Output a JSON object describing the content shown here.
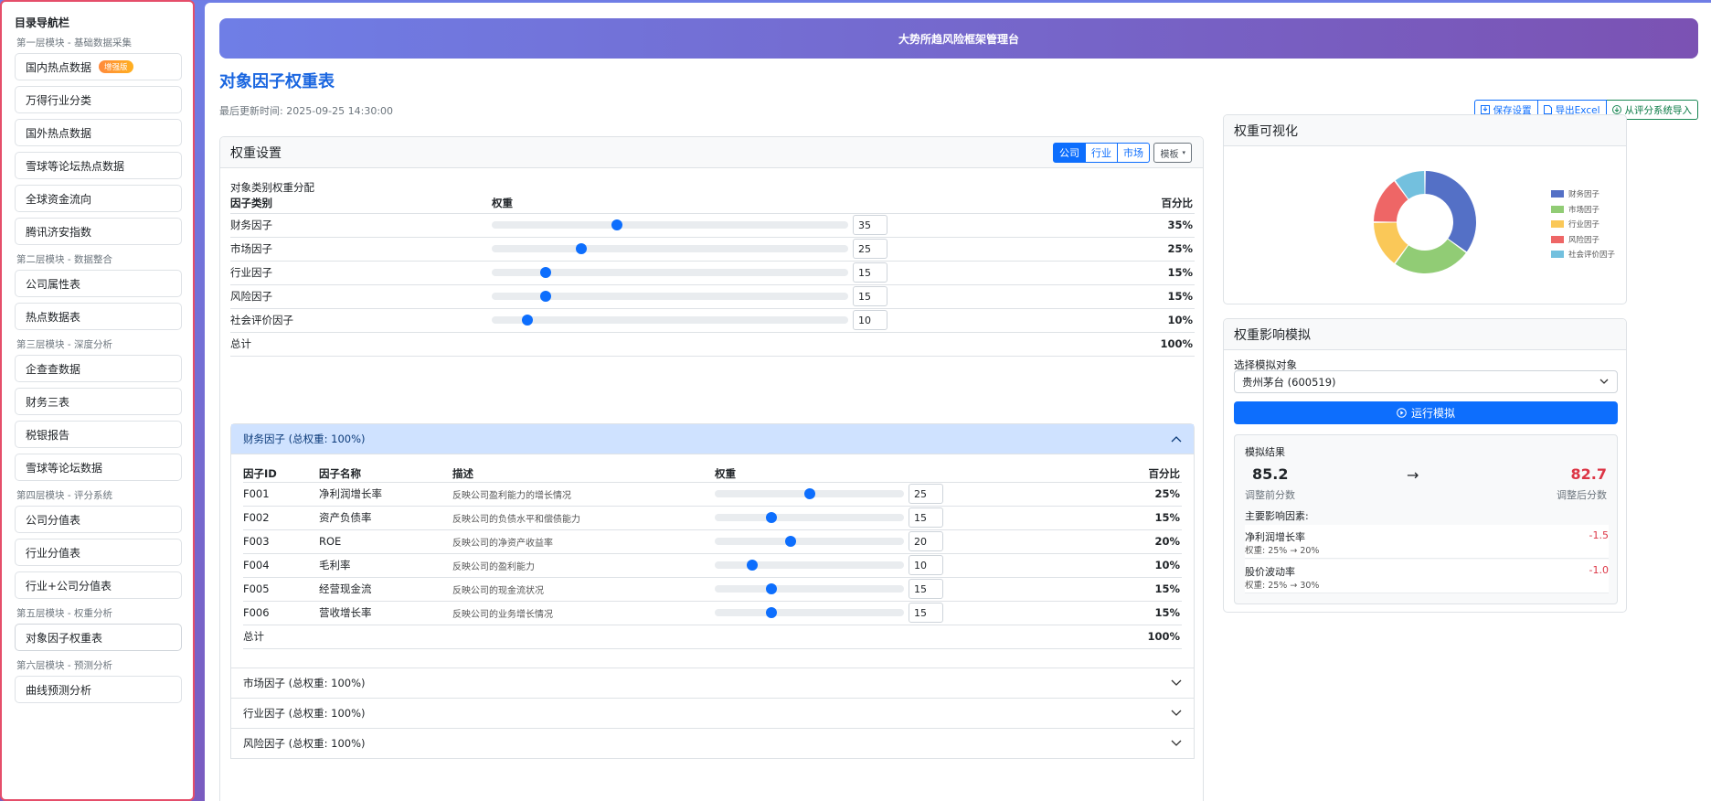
{
  "sidebar": {
    "title": "目录导航栏",
    "sections": [
      {
        "title": "第一层模块 - 基础数据采集",
        "items": [
          {
            "label": "国内热点数据",
            "badge": "增强版"
          },
          {
            "label": "万得行业分类"
          },
          {
            "label": "国外热点数据"
          },
          {
            "label": "雪球等论坛热点数据"
          },
          {
            "label": "全球资金流向"
          },
          {
            "label": "腾讯济安指数"
          }
        ]
      },
      {
        "title": "第二层模块 - 数据整合",
        "items": [
          {
            "label": "公司属性表"
          },
          {
            "label": "热点数据表"
          }
        ]
      },
      {
        "title": "第三层模块 - 深度分析",
        "items": [
          {
            "label": "企查查数据"
          },
          {
            "label": "财务三表"
          },
          {
            "label": "税银报告"
          },
          {
            "label": "雪球等论坛数据"
          }
        ]
      },
      {
        "title": "第四层模块 - 评分系统",
        "items": [
          {
            "label": "公司分值表"
          },
          {
            "label": "行业分值表"
          },
          {
            "label": "行业+公司分值表"
          }
        ]
      },
      {
        "title": "第五层模块 - 权重分析",
        "items": [
          {
            "label": "对象因子权重表",
            "active": true
          }
        ]
      },
      {
        "title": "第六层模块 - 预测分析",
        "items": [
          {
            "label": "曲线预测分析"
          }
        ]
      }
    ]
  },
  "banner": "大势所趋风险框架管理台",
  "page": {
    "title": "对象因子权重表",
    "updated": "最后更新时间: 2025-09-25 14:30:00",
    "actions": {
      "save": "保存设置",
      "export": "导出Excel",
      "import": "从评分系统导入"
    }
  },
  "weights": {
    "title": "权重设置",
    "tabs": [
      "公司",
      "行业",
      "市场"
    ],
    "active_tab": "公司",
    "template": "模板",
    "dist_label": "对象类别权重分配",
    "headers": [
      "因子类别",
      "权重",
      "百分比"
    ],
    "rows": [
      {
        "name": "财务因子",
        "value": "35",
        "pct": "35%",
        "frac": 0.35
      },
      {
        "name": "市场因子",
        "value": "25",
        "pct": "25%",
        "frac": 0.25
      },
      {
        "name": "行业因子",
        "value": "15",
        "pct": "15%",
        "frac": 0.15
      },
      {
        "name": "风险因子",
        "value": "15",
        "pct": "15%",
        "frac": 0.15
      },
      {
        "name": "社会评价因子",
        "value": "10",
        "pct": "10%",
        "frac": 0.1
      }
    ],
    "total_label": "总计",
    "total": "100%"
  },
  "accordion": {
    "open": {
      "title": "财务因子 (总权重: 100%)",
      "headers": [
        "因子ID",
        "因子名称",
        "描述",
        "权重",
        "百分比"
      ],
      "rows": [
        {
          "id": "F001",
          "name": "净利润增长率",
          "desc": "反映公司盈利能力的增长情况",
          "value": "25",
          "pct": "25%",
          "frac": 0.25
        },
        {
          "id": "F002",
          "name": "资产负债率",
          "desc": "反映公司的负债水平和偿债能力",
          "value": "15",
          "pct": "15%",
          "frac": 0.15
        },
        {
          "id": "F003",
          "name": "ROE",
          "desc": "反映公司的净资产收益率",
          "value": "20",
          "pct": "20%",
          "frac": 0.2
        },
        {
          "id": "F004",
          "name": "毛利率",
          "desc": "反映公司的盈利能力",
          "value": "10",
          "pct": "10%",
          "frac": 0.1
        },
        {
          "id": "F005",
          "name": "经营现金流",
          "desc": "反映公司的现金流状况",
          "value": "15",
          "pct": "15%",
          "frac": 0.15
        },
        {
          "id": "F006",
          "name": "营收增长率",
          "desc": "反映公司的业务增长情况",
          "value": "15",
          "pct": "15%",
          "frac": 0.15
        }
      ],
      "total_label": "总计",
      "total": "100%"
    },
    "closed": [
      "市场因子 (总权重: 100%)",
      "行业因子 (总权重: 100%)",
      "风险因子 (总权重: 100%)"
    ]
  },
  "viz": {
    "title": "权重可视化",
    "chart_data": {
      "type": "pie",
      "categories": [
        "财务因子",
        "市场因子",
        "行业因子",
        "风险因子",
        "社会评价因子"
      ],
      "values": [
        35,
        25,
        15,
        15,
        10
      ],
      "colors": [
        "#5470c6",
        "#91cc75",
        "#fac858",
        "#ee6666",
        "#73c0de"
      ],
      "legend": "right"
    }
  },
  "sim": {
    "title": "权重影响模拟",
    "select_label": "选择模拟对象",
    "selected": "贵州茅台 (600519)",
    "run": "运行模拟",
    "result_title": "模拟结果",
    "before": "85.2",
    "before_label": "调整前分数",
    "after": "82.7",
    "after_label": "调整后分数",
    "arrow": "→",
    "factors_title": "主要影响因素:",
    "factors": [
      {
        "name": "净利润增长率",
        "change": "权重: 25% → 20%",
        "delta": "-1.5"
      },
      {
        "name": "股价波动率",
        "change": "权重: 25% → 30%",
        "delta": "-1.0"
      }
    ]
  },
  "colors": {
    "primary": "#0d6efd",
    "title": "#1a66e0",
    "danger": "#dc3545",
    "success": "#198754"
  }
}
